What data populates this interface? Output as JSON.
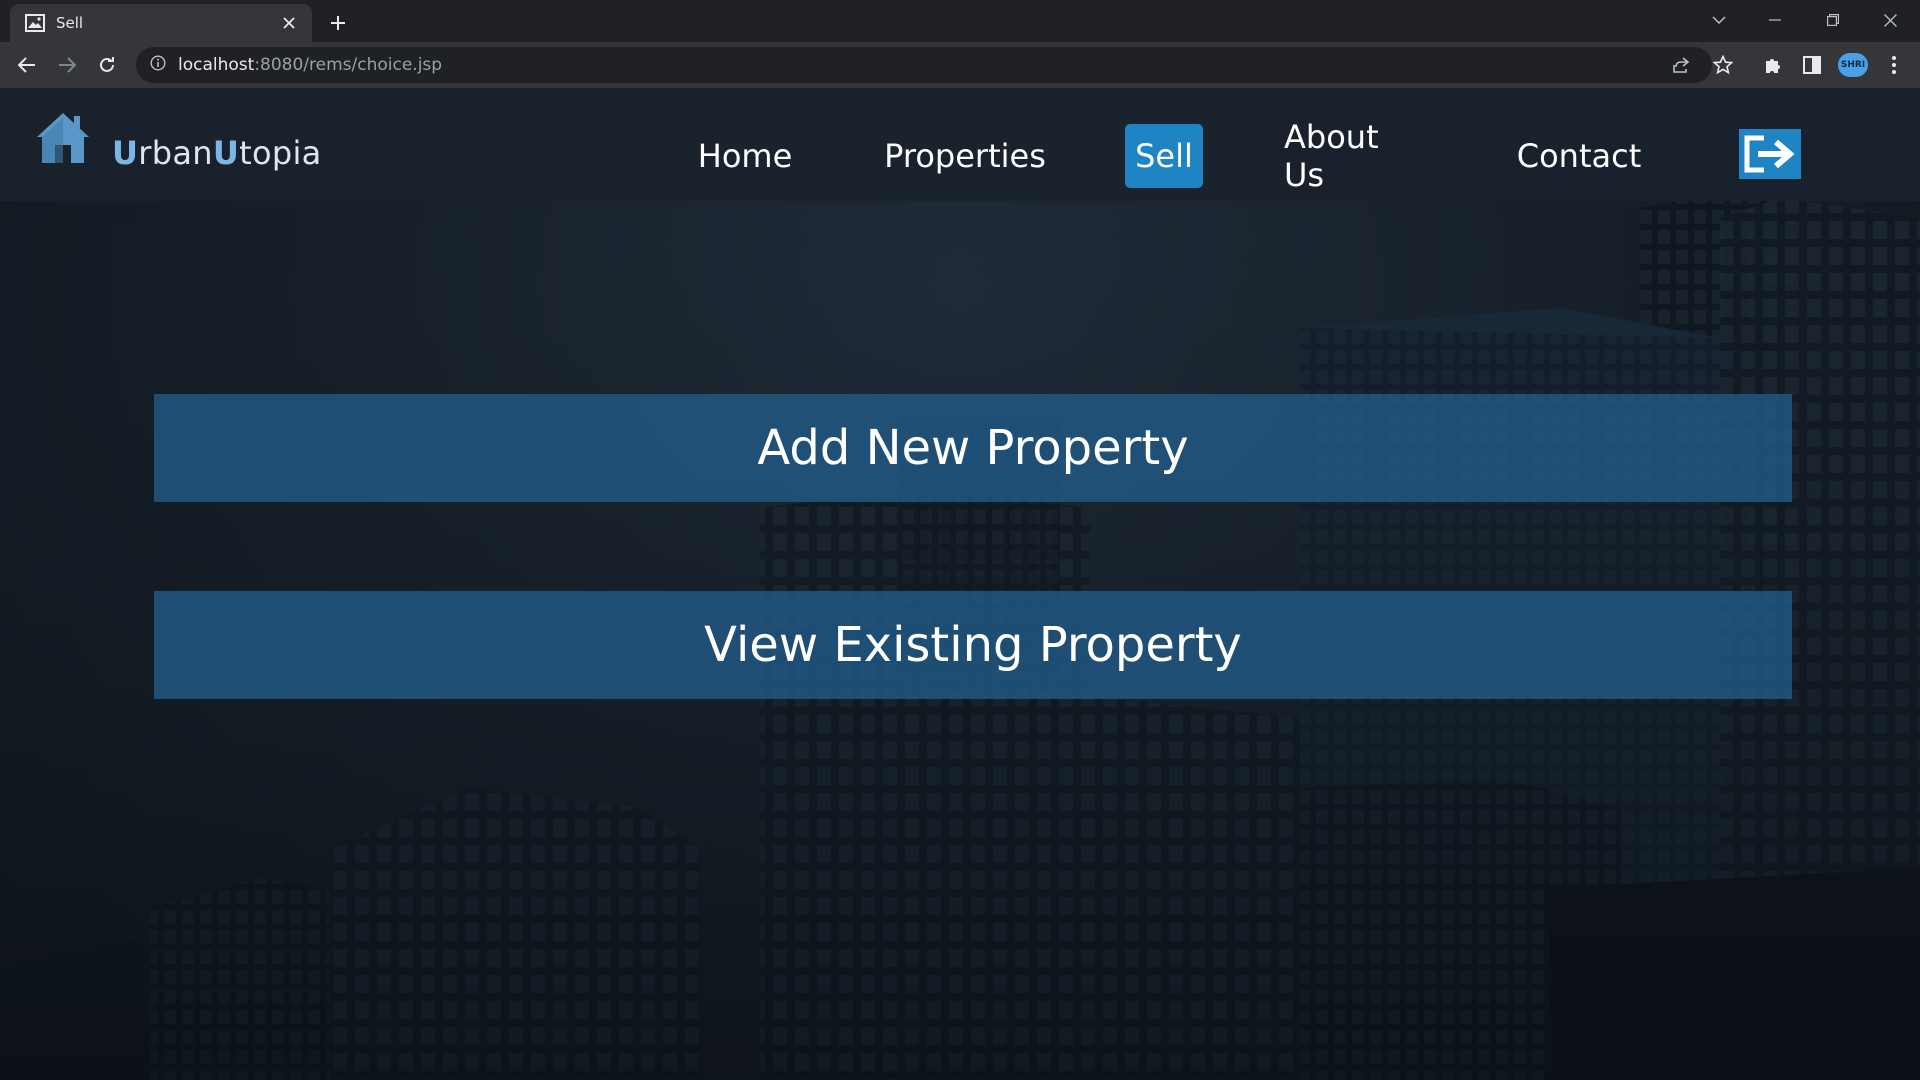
{
  "browser": {
    "tab_title": "Sell",
    "url_host": "localhost",
    "url_rest": ":8080/rems/choice.jsp",
    "profile_label": "SHRI",
    "icons": [
      "image-favicon-icon",
      "close-icon",
      "plus-icon",
      "chevron-down-icon",
      "minimize-icon",
      "restore-icon",
      "window-close-icon",
      "back-arrow-icon",
      "forward-arrow-icon",
      "reload-icon",
      "info-icon",
      "share-icon",
      "star-icon",
      "puzzle-icon",
      "side-panel-icon",
      "kebab-menu-icon"
    ]
  },
  "site": {
    "brand": {
      "first_letter": "U",
      "first_rest": "rban",
      "second_letter": "U",
      "second_rest": "topia"
    },
    "nav": [
      {
        "label": "Home",
        "active": false
      },
      {
        "label": "Properties",
        "active": false
      },
      {
        "label": "Sell",
        "active": true
      },
      {
        "label": "About Us",
        "active": false
      },
      {
        "label": "Contact",
        "active": false
      }
    ],
    "choices": [
      {
        "label": "Add New Property"
      },
      {
        "label": "View Existing Property"
      }
    ],
    "colors": {
      "accent": "#1e84c4",
      "choice_bg": "#225c8a",
      "logo": "#5a97c8"
    }
  }
}
